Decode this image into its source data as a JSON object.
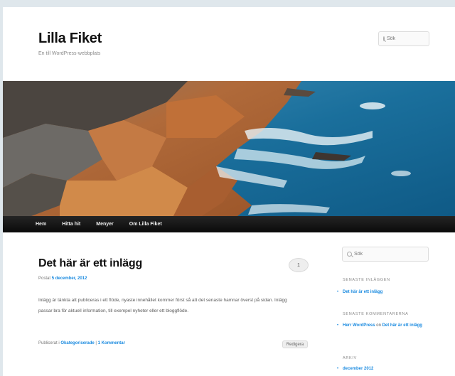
{
  "header": {
    "site_title": "Lilla Fiket",
    "site_description": "En till WordPress-webbplats",
    "search_placeholder": "Sök"
  },
  "banner": {
    "icon": "rocky-coast-image"
  },
  "nav": {
    "items": [
      "Hem",
      "Hitta hit",
      "Menyer",
      "Om Lilla Fiket"
    ]
  },
  "post": {
    "title": "Det här är ett inlägg",
    "comment_count": "1",
    "meta_prefix": "Postat ",
    "date": "5 december, 2012",
    "body": "Inlägg är tänkta att publiceras i ett flöde, nyaste innehållet kommer först så att det senaste hamnar överst på sidan. Inlägg passar bra för aktuell information, till exempel nyheter eller ett bloggflöde.",
    "footer_prefix": "Publicerat i ",
    "category": "Okategoriserade",
    "separator": " | ",
    "comments_link": "1 Kommentar",
    "edit_label": "Redigera"
  },
  "sidebar": {
    "search_placeholder": "Sök",
    "recent_posts": {
      "title": "SENASTE INLÄGGEN",
      "items": [
        "Det här är ett inlägg"
      ]
    },
    "recent_comments": {
      "title": "SENASTE KOMMENTARERNA",
      "author": "Herr WordPress",
      "on": " on ",
      "post": "Det här är ett inlägg"
    },
    "archive": {
      "title": "ARKIV",
      "items": [
        "december 2012"
      ]
    }
  },
  "colors": {
    "link": "#1b8be0",
    "nav_bg": "#111111",
    "page_bg": "#dfe7ec"
  }
}
